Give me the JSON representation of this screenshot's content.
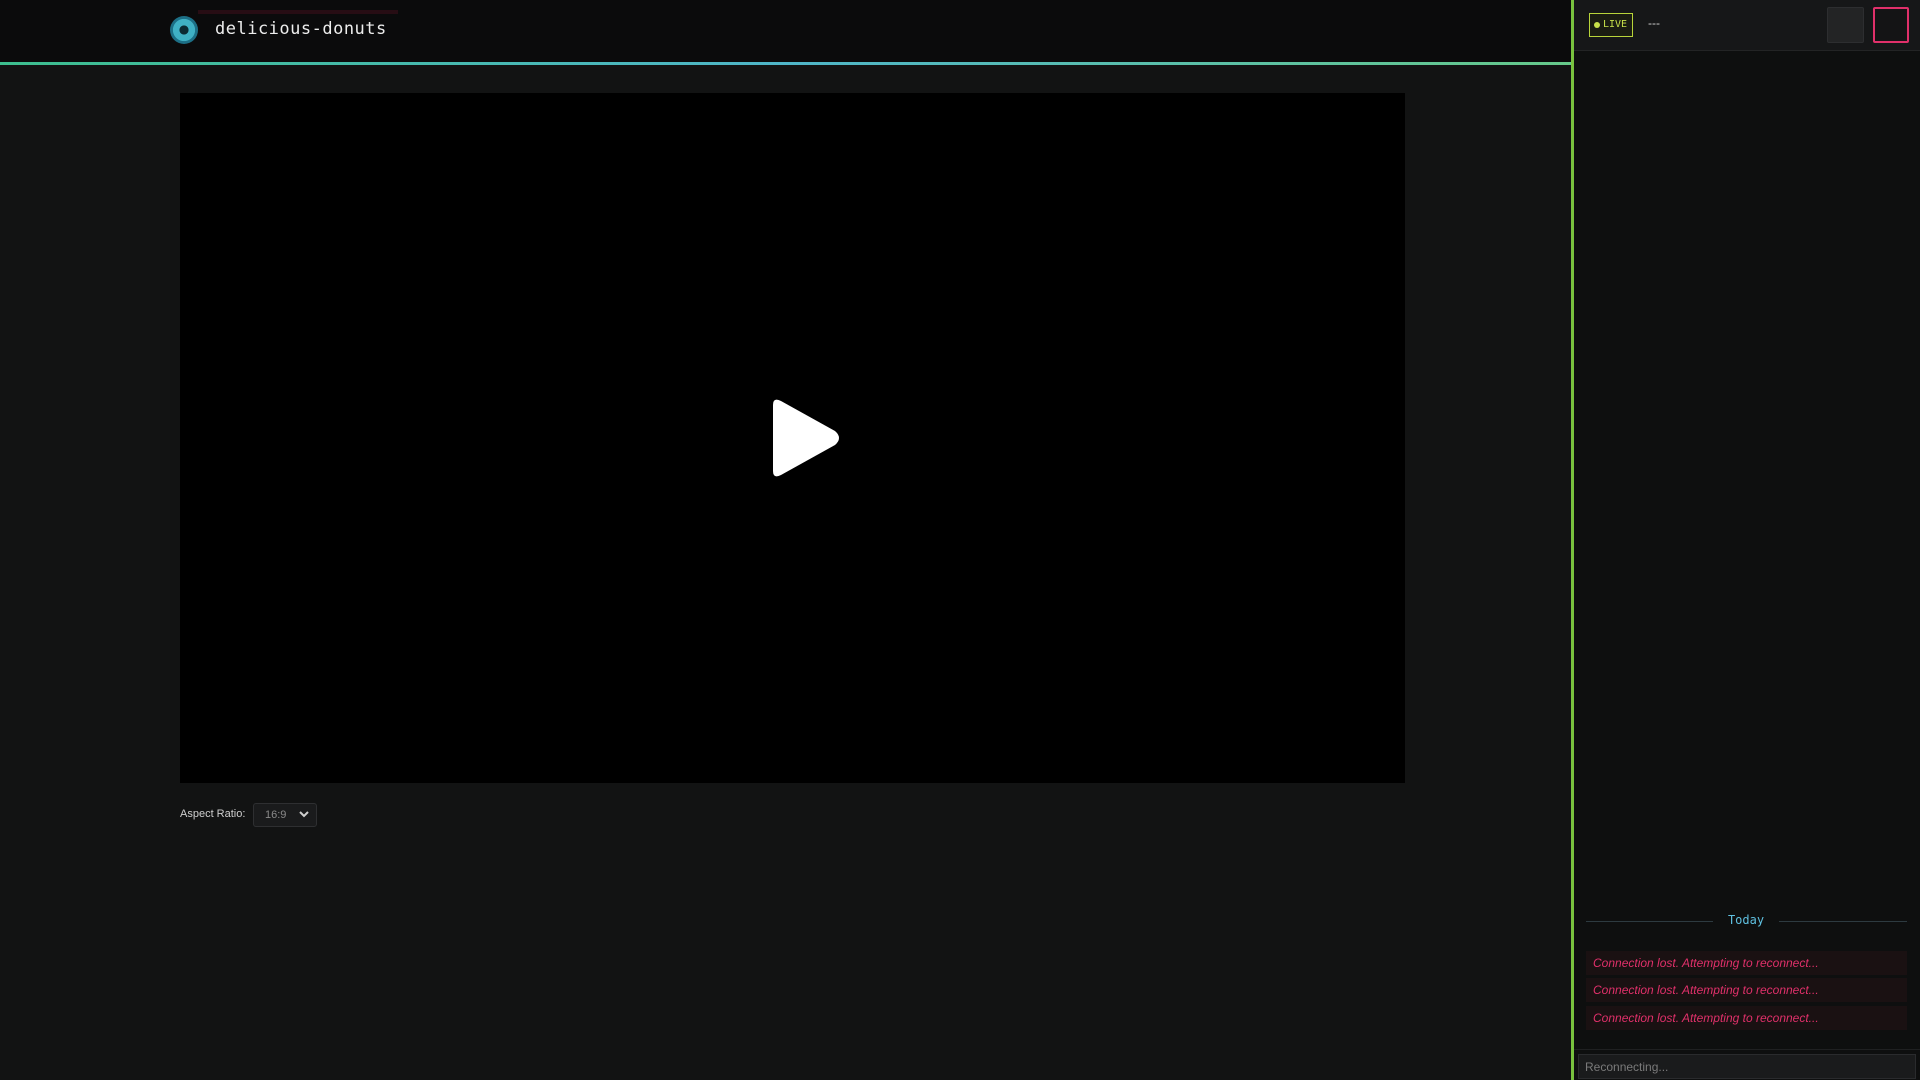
{
  "header": {
    "channel_name": "delicious-donuts",
    "logo": "donut-logo-icon"
  },
  "player": {
    "play_icon": "play-icon"
  },
  "controls": {
    "aspect_ratio_label": "Aspect Ratio:",
    "aspect_ratio_value": "16:9"
  },
  "sidebar": {
    "live_label": "LIVE",
    "viewer_count": "---",
    "day_label": "Today",
    "messages": [
      "Connection lost. Attempting to reconnect...",
      "Connection lost. Attempting to reconnect...",
      "Connection lost. Attempting to reconnect..."
    ],
    "input_placeholder": "Reconnecting..."
  },
  "colors": {
    "accent_green": "#79c23e",
    "accent_pink": "#e0306a",
    "accent_cyan": "#5fc0e0",
    "live_yellow": "#c7e04a"
  }
}
